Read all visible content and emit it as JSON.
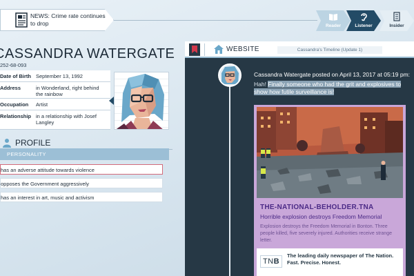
{
  "news": {
    "label": "NEWS: Crime rate continues to drop"
  },
  "stages": [
    {
      "label": "Reader",
      "icon": "book-icon",
      "state": "completed"
    },
    {
      "label": "Listener",
      "icon": "ear-icon",
      "state": "active"
    },
    {
      "label": "Insider",
      "icon": "document-icon",
      "state": "locked"
    }
  ],
  "profile": {
    "name": "CASSANDRA WATERGATE",
    "phone": "252-68-093",
    "fields": [
      {
        "key": "Date of Birth",
        "value": "September 13, 1992"
      },
      {
        "key": "Address",
        "value": "in Wonderland, right behind the rainbow"
      },
      {
        "key": "Occupation",
        "value": "Artist"
      },
      {
        "key": "Relationship",
        "value": "in a relationship with Josef Langley"
      }
    ],
    "section_title": "PROFILE",
    "personality_label": "PERSONALITY",
    "traits": [
      "has an adverse attitude towards violence",
      "opposes the Government aggressively",
      "has an interest in art, music and activism"
    ]
  },
  "website": {
    "title": "WEBSITE",
    "timeline_label": "Cassandra's Timeline (Update 1)",
    "post_header": "Cassandra Watergate posted on April 13, 2017 at 05:19 pm:",
    "post_prefix": "Hah! ",
    "post_highlight": "Finally someone who had the grit and explosives to show how futile surveillance is!",
    "article": {
      "source": "THE-NATIONAL-BEHOLDER.TNA",
      "headline": "Horrible explosion destroys Freedom Memorial",
      "excerpt": "Explosion destroys the Freedom Memorial in Bonton. Three people killed, five severely injured. Authorities receive strange letter."
    },
    "ad": {
      "logo_plain": "TN",
      "logo_bold": "B",
      "text": "The leading daily newspaper of The Nation. Fast. Precise. Honest."
    }
  },
  "colors": {
    "accent_dark": "#234b66",
    "accent_light": "#9cbfd6",
    "website_bg": "#263845",
    "article_card": "#c9a7d9",
    "article_text": "#4b2a86",
    "flag_red": "#d1394b"
  }
}
